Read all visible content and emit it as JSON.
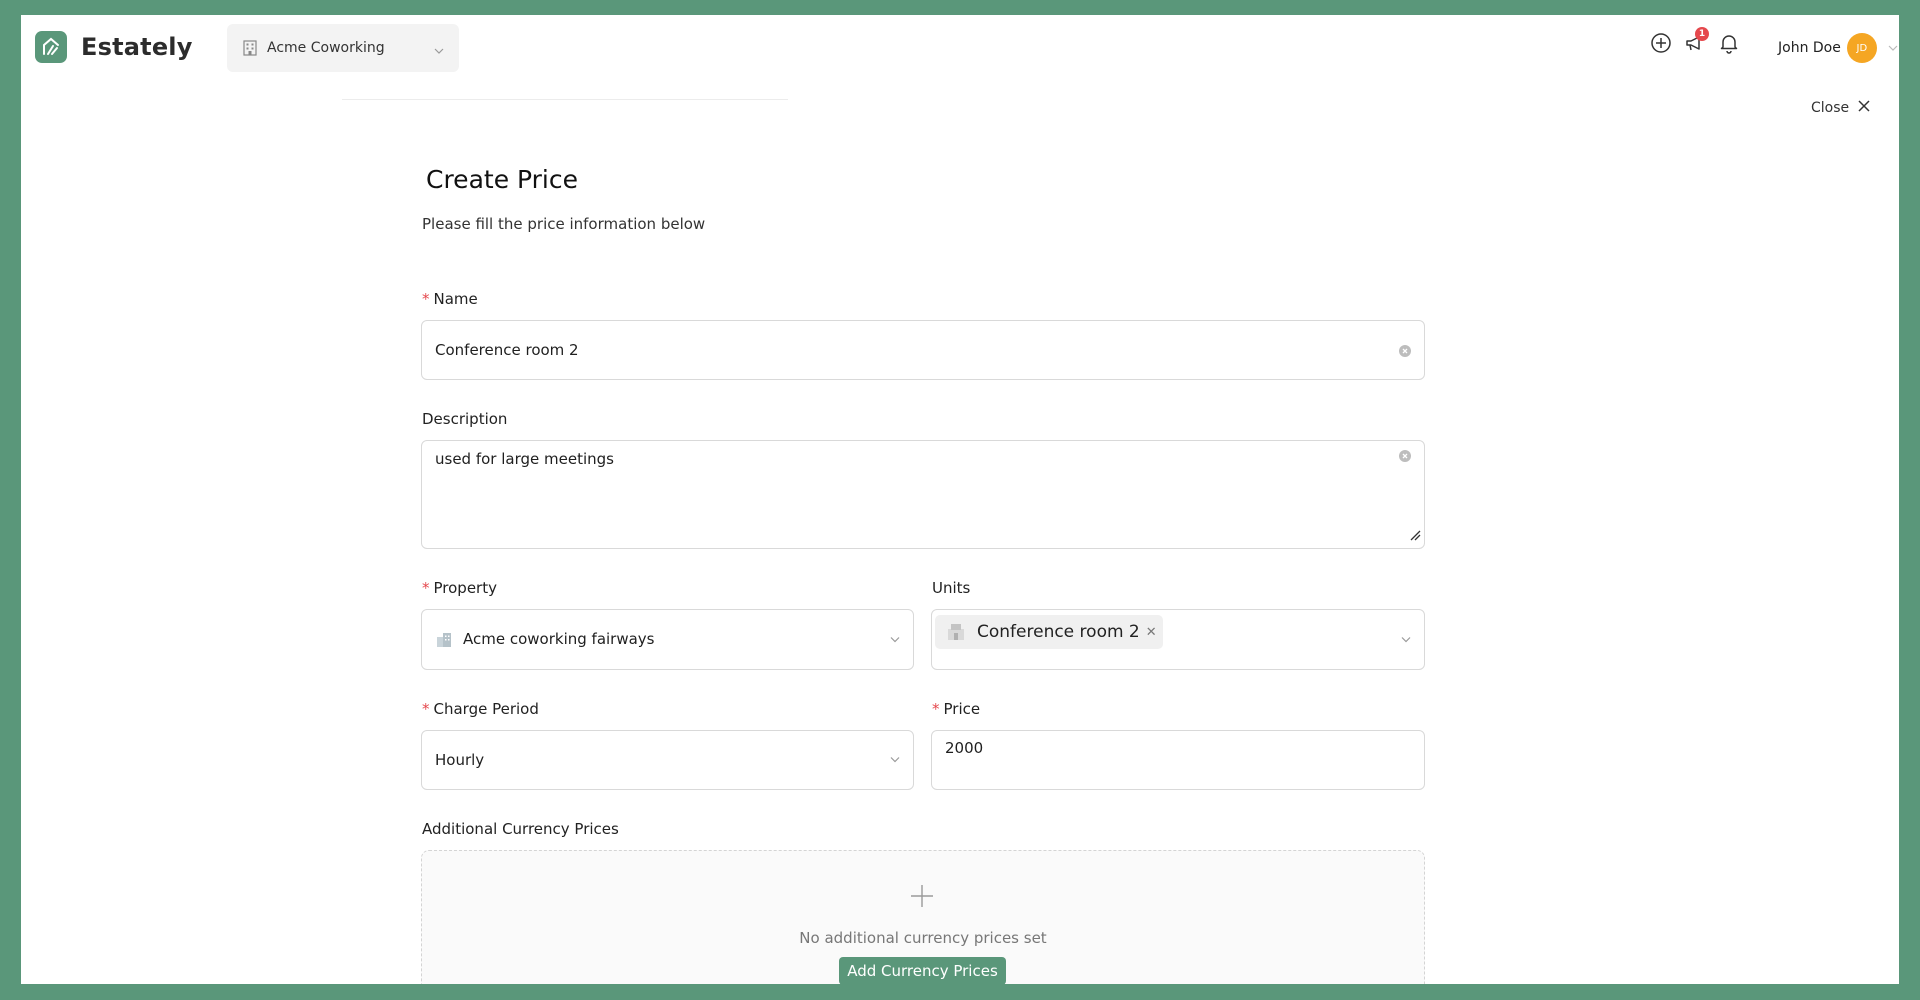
{
  "app": {
    "brand": "Estately",
    "accent_color": "#5a977a"
  },
  "org_selector": {
    "value": "Acme Coworking",
    "icon": "building-icon"
  },
  "header_actions": [
    {
      "name": "add-circle-icon"
    },
    {
      "name": "announcement-icon",
      "badge": "1"
    },
    {
      "name": "bell-icon"
    }
  ],
  "user": {
    "name": "John Doe",
    "initials": "JD"
  },
  "close": {
    "label": "Close"
  },
  "form": {
    "title": "Create Price",
    "subtitle": "Please fill the price information below",
    "name": {
      "label": "Name",
      "required": true,
      "value": "Conference room 2"
    },
    "description": {
      "label": "Description",
      "value": "used for large meetings"
    },
    "property": {
      "label": "Property",
      "required": true,
      "value": "Acme coworking fairways"
    },
    "units": {
      "label": "Units",
      "selected_tags": [
        "Conference room 2"
      ]
    },
    "charge_period": {
      "label": "Charge Period",
      "required": true,
      "value": "Hourly"
    },
    "price": {
      "label": "Price",
      "required": true,
      "value": "2000"
    },
    "additional_currency": {
      "label": "Additional Currency Prices",
      "empty_text": "No additional currency prices set",
      "button_label": "Add Currency Prices"
    }
  }
}
